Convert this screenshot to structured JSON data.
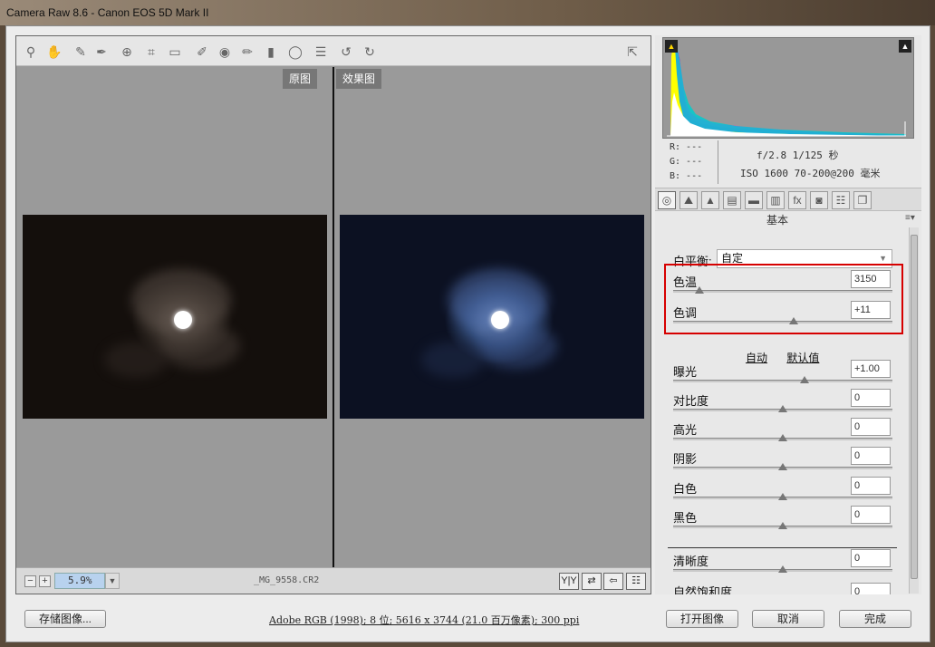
{
  "window": {
    "title": "Camera Raw 8.6 -  Canon EOS 5D Mark II"
  },
  "toolbar": {
    "tools": [
      {
        "name": "zoom-icon",
        "glyph": "⚲"
      },
      {
        "name": "hand-icon",
        "glyph": "✋"
      },
      {
        "name": "white-balance-icon",
        "glyph": "✎"
      },
      {
        "name": "color-sampler-icon",
        "glyph": "✒"
      },
      {
        "name": "target-adjust-icon",
        "glyph": "⊕"
      },
      {
        "name": "crop-icon",
        "glyph": "⌗"
      },
      {
        "name": "straighten-icon",
        "glyph": "▭"
      },
      {
        "name": "spot-removal-icon",
        "glyph": "✐"
      },
      {
        "name": "red-eye-icon",
        "glyph": "◉"
      },
      {
        "name": "adjustment-brush-icon",
        "glyph": "✏"
      },
      {
        "name": "graduated-filter-icon",
        "glyph": "▮"
      },
      {
        "name": "radial-filter-icon",
        "glyph": "◯"
      },
      {
        "name": "preferences-icon",
        "glyph": "☰"
      },
      {
        "name": "rotate-left-icon",
        "glyph": "↺"
      },
      {
        "name": "rotate-right-icon",
        "glyph": "↻"
      }
    ],
    "fullscreen_icon": "⇱"
  },
  "preview": {
    "before_label": "原图",
    "after_label": "效果图"
  },
  "statusbar": {
    "zoom_out": "−",
    "zoom_in": "+",
    "zoom_value": "5.9%",
    "zoom_dropdown": "▼",
    "filename": "_MG_9558.CR2",
    "view_buttons": [
      "Y|Y",
      "⇄",
      "⇦",
      "☷"
    ]
  },
  "histogram": {
    "shadow_clip_icon": "▲",
    "highlight_clip_icon": "▲"
  },
  "readout": {
    "r": "R:  ---",
    "g": "G:  ---",
    "b": "B:  ---",
    "aperture_shutter": "f/2.8   1/125 秒",
    "iso_lens": "ISO 1600   70-200@200 毫米"
  },
  "panel_tabs": [
    "◎",
    "⛰",
    "▲",
    "▤",
    "▬",
    "▥",
    "fx",
    "◙",
    "☷",
    "❐"
  ],
  "basic": {
    "section_title": "基本",
    "menu_icon": "≡▾",
    "white_balance_label": "白平衡:",
    "white_balance_value": "自定",
    "auto_label": "自动",
    "default_label": "默认值",
    "sliders": [
      {
        "label": "色温",
        "value": "3150",
        "fraction": 0.12
      },
      {
        "label": "色调",
        "value": "+11",
        "fraction": 0.55
      },
      {
        "label": "曝光",
        "value": "+1.00",
        "fraction": 0.6
      },
      {
        "label": "对比度",
        "value": "0",
        "fraction": 0.5
      },
      {
        "label": "高光",
        "value": "0",
        "fraction": 0.5
      },
      {
        "label": "阴影",
        "value": "0",
        "fraction": 0.5
      },
      {
        "label": "白色",
        "value": "0",
        "fraction": 0.5
      },
      {
        "label": "黑色",
        "value": "0",
        "fraction": 0.5
      },
      {
        "label": "清晰度",
        "value": "0",
        "fraction": 0.5
      },
      {
        "label": "自然饱和度",
        "value": "0",
        "fraction": 0.5
      }
    ]
  },
  "footer": {
    "save_label": "存储图像...",
    "workflow_info": "Adobe RGB (1998); 8 位; 5616 x 3744 (21.0 百万像素); 300 ppi",
    "open_label": "打开图像",
    "cancel_label": "取消",
    "done_label": "完成"
  }
}
